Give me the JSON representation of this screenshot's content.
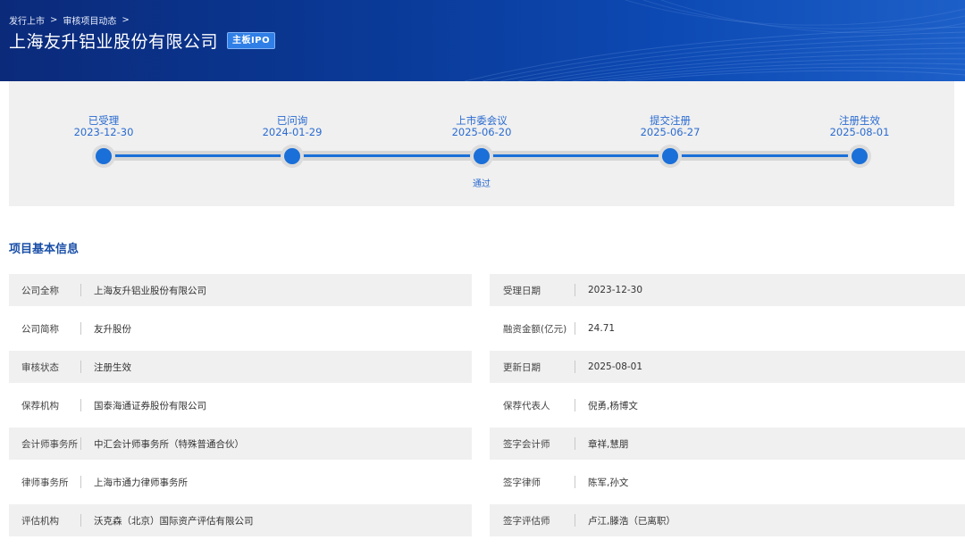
{
  "breadcrumb": {
    "items": [
      "发行上市",
      "审核项目动态"
    ],
    "separator": ">"
  },
  "header": {
    "company_name": "上海友升铝业股份有限公司",
    "board_badge": "主板IPO"
  },
  "timeline": {
    "stages": [
      {
        "label": "已受理",
        "date": "2023-12-30",
        "note": ""
      },
      {
        "label": "已问询",
        "date": "2024-01-29",
        "note": ""
      },
      {
        "label": "上市委会议",
        "date": "2025-06-20",
        "note": "通过"
      },
      {
        "label": "提交注册",
        "date": "2025-06-27",
        "note": ""
      },
      {
        "label": "注册生效",
        "date": "2025-08-01",
        "note": ""
      }
    ]
  },
  "section": {
    "title": "项目基本信息"
  },
  "info": {
    "left": [
      {
        "label": "公司全称",
        "value": "上海友升铝业股份有限公司"
      },
      {
        "label": "公司简称",
        "value": "友升股份"
      },
      {
        "label": "审核状态",
        "value": "注册生效"
      },
      {
        "label": "保荐机构",
        "value": "国泰海通证券股份有限公司"
      },
      {
        "label": "会计师事务所",
        "value": "中汇会计师事务所（特殊普通合伙）"
      },
      {
        "label": "律师事务所",
        "value": "上海市通力律师事务所"
      },
      {
        "label": "评估机构",
        "value": "沃克森（北京）国际资产评估有限公司"
      }
    ],
    "right": [
      {
        "label": "受理日期",
        "value": "2023-12-30"
      },
      {
        "label": "融资金额(亿元)",
        "value": "24.71"
      },
      {
        "label": "更新日期",
        "value": "2025-08-01"
      },
      {
        "label": "保荐代表人",
        "value": "倪勇,杨博文"
      },
      {
        "label": "签字会计师",
        "value": "章祥,慧朋"
      },
      {
        "label": "签字律师",
        "value": "陈军,孙文"
      },
      {
        "label": "签字评估师",
        "value": "卢江,滕浩（已离职）"
      }
    ]
  },
  "colors": {
    "banner": "#0a3a98",
    "accent": "#1a6fd8",
    "title_blue": "#1a4fa8",
    "row_shade": "#f0f0f0"
  }
}
